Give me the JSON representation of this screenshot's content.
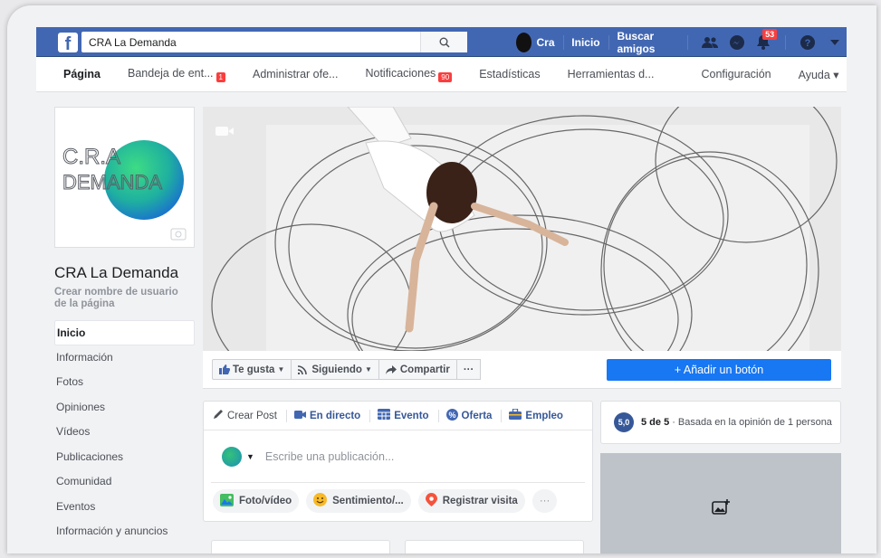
{
  "topbar": {
    "search_value": "CRA La Demanda",
    "user_name": "Cra",
    "home_label": "Inicio",
    "find_friends_label": "Buscar amigos",
    "notifications_count": "53",
    "brand_color": "#4267b2"
  },
  "tabs": [
    {
      "label": "Página"
    },
    {
      "label": "Bandeja de ent...",
      "badge": "1"
    },
    {
      "label": "Administrar ofe..."
    },
    {
      "label": "Notificaciones",
      "badge": "90"
    },
    {
      "label": "Estadísticas"
    },
    {
      "label": "Herramientas d..."
    },
    {
      "label": "Configuración"
    },
    {
      "label": "Ayuda ▾"
    }
  ],
  "page": {
    "logo_text_line1": "C.R.A",
    "logo_text_line2": "DEMANDA",
    "name": "CRA La Demanda",
    "username_prompt": "Crear nombre de usuario de la página"
  },
  "sidebar": {
    "items": [
      {
        "label": "Inicio"
      },
      {
        "label": "Información"
      },
      {
        "label": "Fotos"
      },
      {
        "label": "Opiniones"
      },
      {
        "label": "Vídeos"
      },
      {
        "label": "Publicaciones"
      },
      {
        "label": "Comunidad"
      },
      {
        "label": "Eventos"
      },
      {
        "label": "Información y anuncios"
      }
    ]
  },
  "actions": {
    "like_label": "Te gusta",
    "following_label": "Siguiendo",
    "share_label": "Compartir",
    "more_label": "···",
    "add_button_label": "+ Añadir un botón",
    "accent_color": "#1877f2"
  },
  "composer": {
    "tabs": [
      "Crear Post",
      "En directo",
      "Evento",
      "Oferta",
      "Empleo"
    ],
    "placeholder": "Escribe una publicación...",
    "footer": [
      "Foto/vídeo",
      "Sentimiento/...",
      "Registrar visita",
      "···"
    ]
  },
  "rating": {
    "score": "5,0",
    "headline": "5 de 5",
    "detail": "· Basada en la opinión de 1 persona"
  }
}
